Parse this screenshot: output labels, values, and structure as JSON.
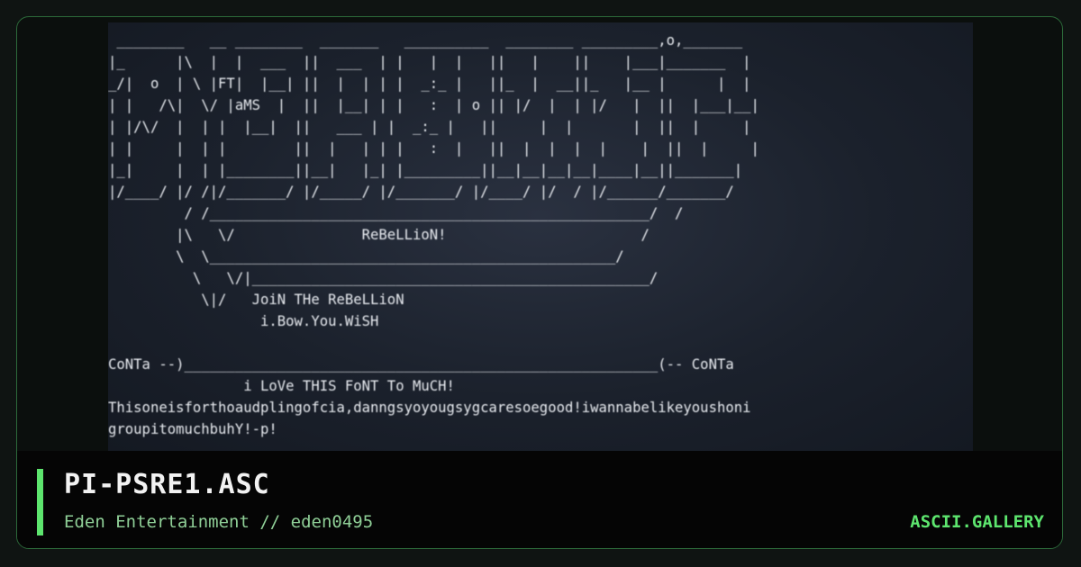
{
  "artwork": {
    "lines": [
      " ________   __ ________  _______   __________  ________ _________,o,_______ ",
      "|_      |\\  |  |  ___  ||  ___  | |   |  |   ||   |    ||    |___|_______  |",
      "_/|  o  | \\ |FT|  |__| ||  |  | | |  _:_ |   ||_  |  __||_   |__ |      |  |",
      "| |   /\\|  \\/ |aMS  |  ||  |__| | |   :  | o || |/  |  | |/   |  ||  |___|__|",
      "| |/\\/  |  | |  |__|  ||   ___ | |  _:_ |   ||     |  |       |  ||  |     |",
      "| |     |  | |        ||  |   | | |   :  |   ||  |  |  |  |    |  ||  |     |",
      "|_|     |  | |________||__|   |_| |_________||__|__|__|__|____|__||_______|",
      "|/____/ |/ /|/_______/ |/_____/ |/_______/ |/____/ |/  / |/______/_______/  ",
      "         / /____________________________________________________/  /       ",
      "        |\\   \\/               ReBeLLioN!                       /          ",
      "        \\  \\________________________________________________/            ",
      "          \\   \\/|_______________________________________________/          ",
      "           \\|/   JoiN THe ReBeLLioN                                        ",
      "                  i.Bow.You.WiSH                                            ",
      "                                                                            ",
      "CoNTa --)________________________________________________________(-- CoNTa",
      "                i LoVe THIS FoNT To MuCH!                                   ",
      "Thisoneisforthoaudplingofcia,danngsyoyougsygcaresoegood!iwannabelikeyoushoni",
      "groupitomuchbuhY!-p!                                                        "
    ]
  },
  "footer": {
    "title": "PI-PSRE1.ASC",
    "subtitle": "Eden Entertainment // eden0495",
    "brand": "ASCII.GALLERY"
  },
  "colors": {
    "accent": "#5de56e",
    "subtitle": "#8fcf97",
    "art_background": "#1b212c",
    "art_text": "#e9ecf1"
  }
}
